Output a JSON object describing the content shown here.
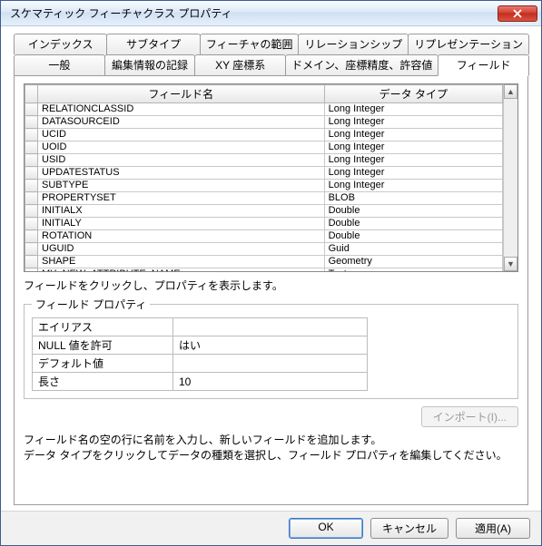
{
  "window": {
    "title": "スケマティック フィーチャクラス プロパティ"
  },
  "tabs_row1": [
    {
      "label": "インデックス"
    },
    {
      "label": "サブタイプ"
    },
    {
      "label": "フィーチャの範囲"
    },
    {
      "label": "リレーションシップ"
    },
    {
      "label": "リプレゼンテーション"
    }
  ],
  "tabs_row2": [
    {
      "label": "一般"
    },
    {
      "label": "編集情報の記録"
    },
    {
      "label": "XY 座標系"
    },
    {
      "label": "ドメイン、座標精度、許容値"
    },
    {
      "label": "フィールド",
      "active": true
    }
  ],
  "field_table": {
    "headers": {
      "name": "フィールド名",
      "type": "データ タイプ"
    },
    "rows": [
      {
        "name": "RELATIONCLASSID",
        "type": "Long Integer"
      },
      {
        "name": "DATASOURCEID",
        "type": "Long Integer"
      },
      {
        "name": "UCID",
        "type": "Long Integer"
      },
      {
        "name": "UOID",
        "type": "Long Integer"
      },
      {
        "name": "USID",
        "type": "Long Integer"
      },
      {
        "name": "UPDATESTATUS",
        "type": "Long Integer"
      },
      {
        "name": "SUBTYPE",
        "type": "Long Integer"
      },
      {
        "name": "PROPERTYSET",
        "type": "BLOB"
      },
      {
        "name": "INITIALX",
        "type": "Double"
      },
      {
        "name": "INITIALY",
        "type": "Double"
      },
      {
        "name": "ROTATION",
        "type": "Double"
      },
      {
        "name": "UGUID",
        "type": "Guid"
      },
      {
        "name": "SHAPE",
        "type": "Geometry"
      },
      {
        "name": "MY_NEW_ATTRIBUTE_NAME",
        "type": "Text"
      }
    ]
  },
  "hint_click": "フィールドをクリックし、プロパティを表示します。",
  "props": {
    "legend": "フィールド プロパティ",
    "rows": [
      {
        "label": "エイリアス",
        "value": ""
      },
      {
        "label": "NULL 値を許可",
        "value": "はい"
      },
      {
        "label": "デフォルト値",
        "value": ""
      },
      {
        "label": "長さ",
        "value": "10"
      }
    ]
  },
  "import_btn": "インポート(I)...",
  "hint_bottom_l1": "フィールド名の空の行に名前を入力し、新しいフィールドを追加します。",
  "hint_bottom_l2": "データ タイプをクリックしてデータの種類を選択し、フィールド プロパティを編集してください。",
  "footer": {
    "ok": "OK",
    "cancel": "キャンセル",
    "apply": "適用(A)"
  }
}
